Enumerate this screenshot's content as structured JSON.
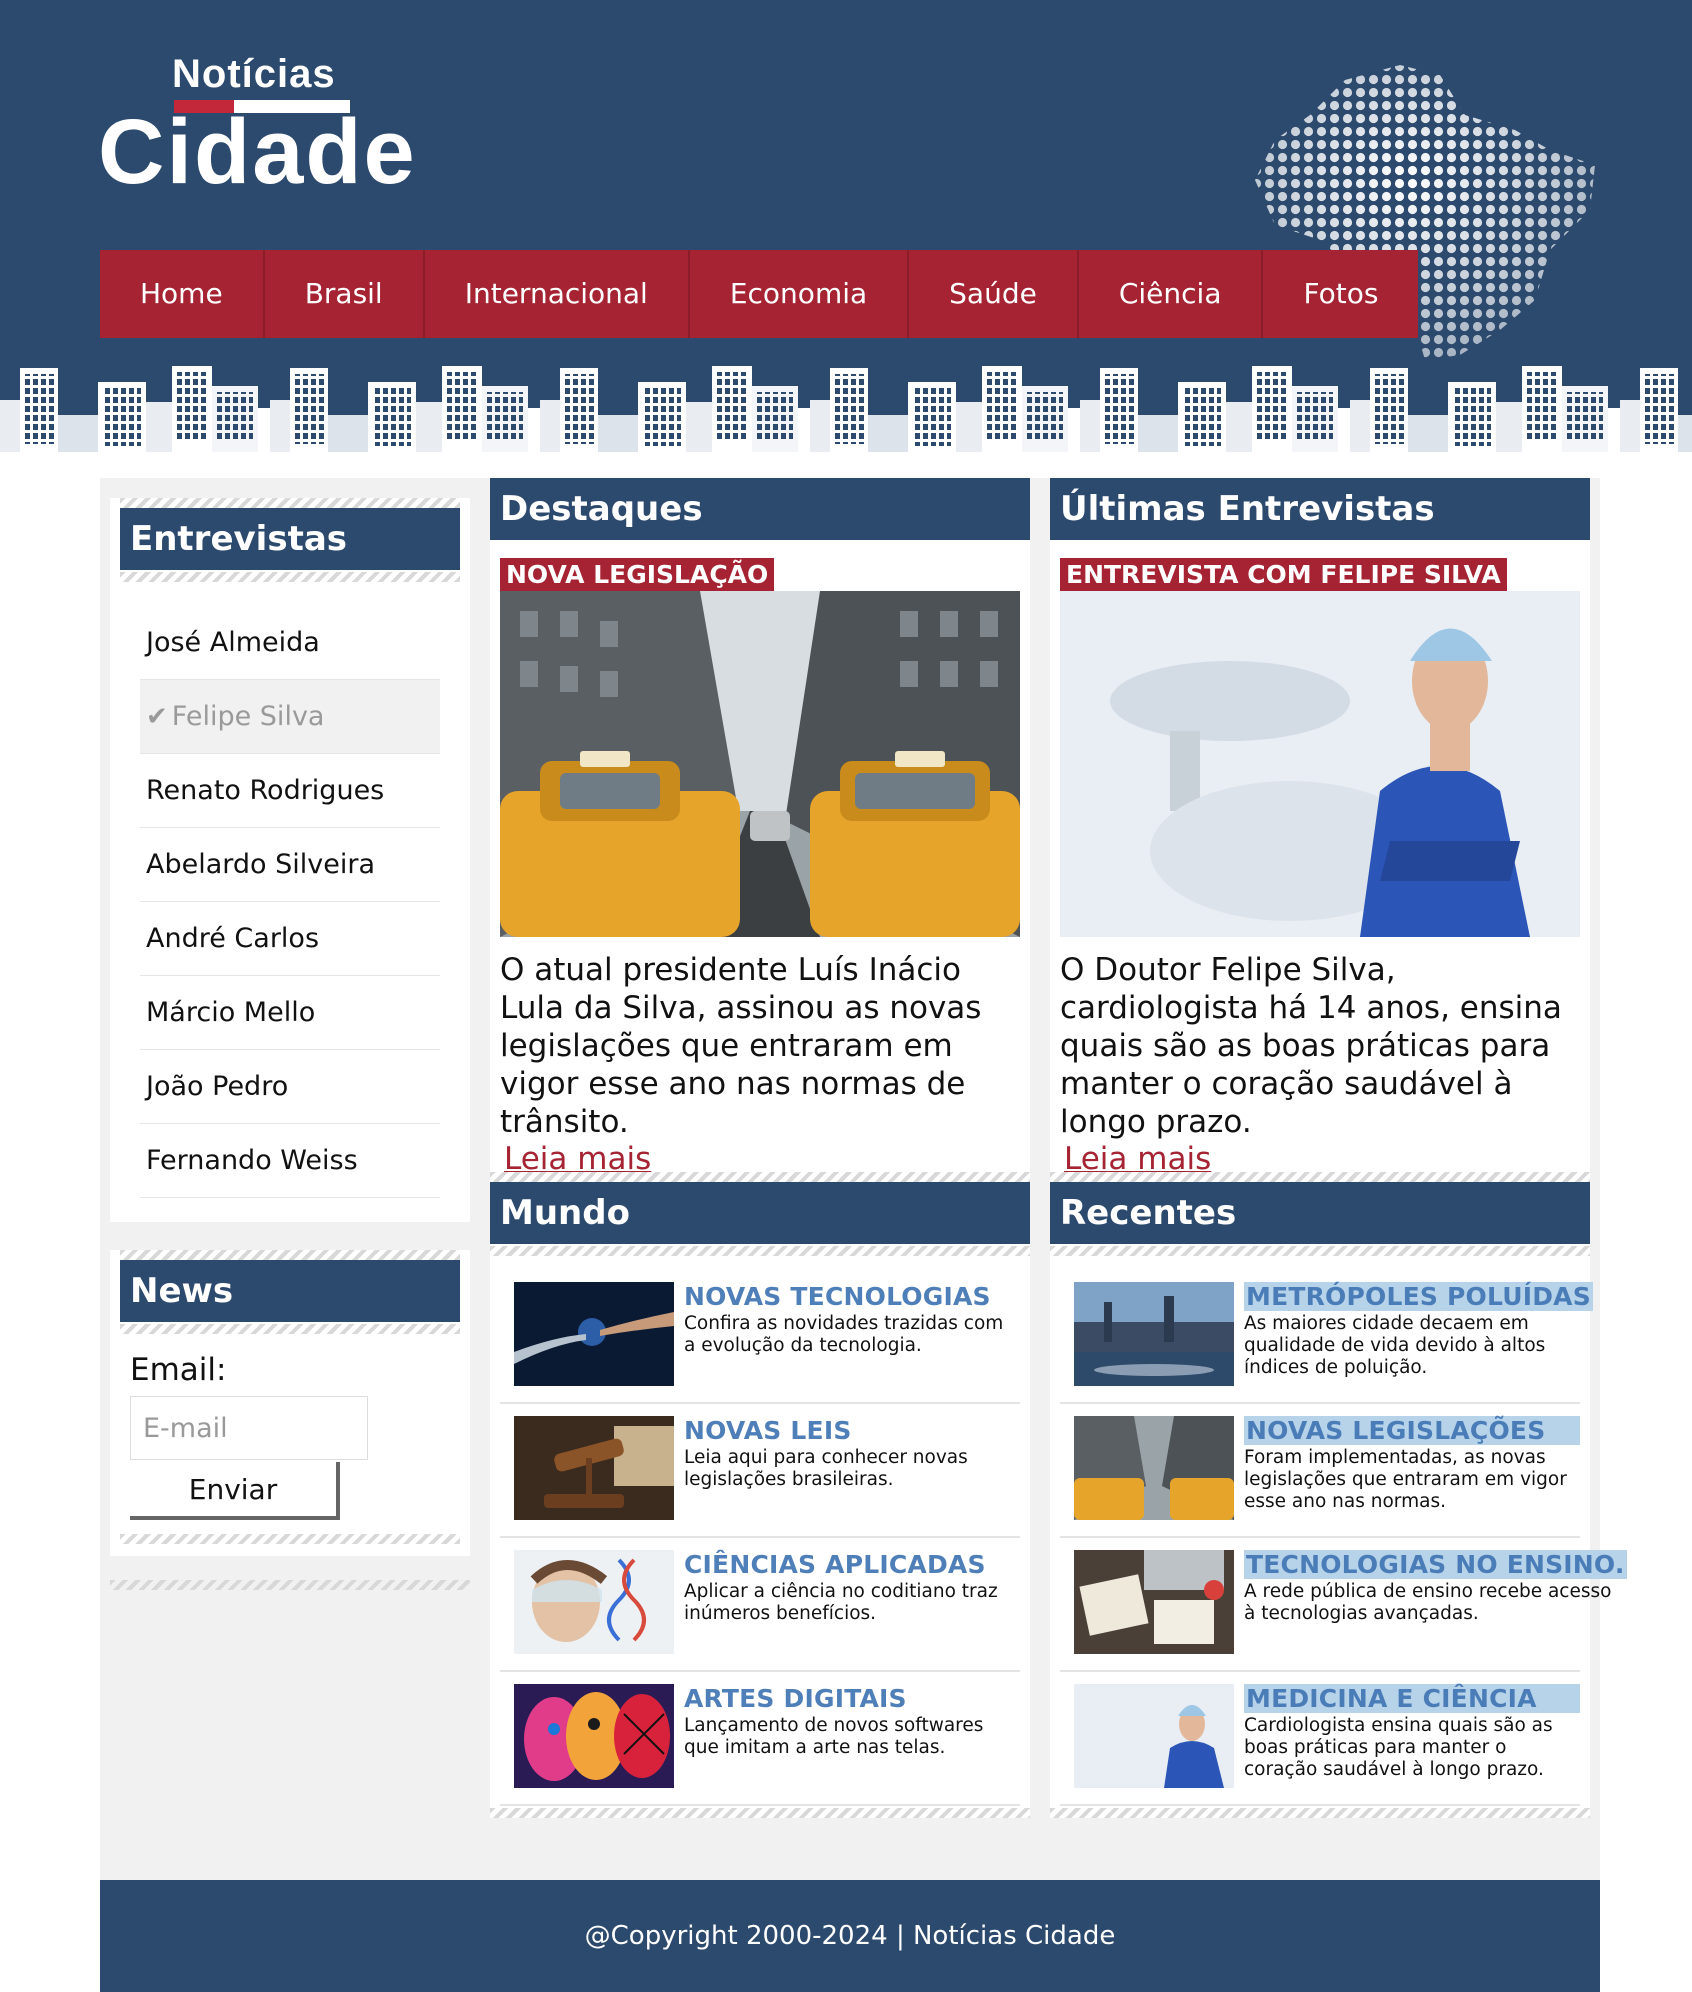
{
  "header": {
    "logo_small": "Notícias",
    "logo_big": "Cidade",
    "nav": [
      "Home",
      "Brasil",
      "Internacional",
      "Economia",
      "Saúde",
      "Ciência",
      "Fotos"
    ]
  },
  "sidebar": {
    "interviews_title": "Entrevistas",
    "interviews": [
      "José Almeida",
      "Felipe Silva",
      "Renato Rodrigues",
      "Abelardo Silveira",
      "André Carlos",
      "Márcio Mello",
      "João Pedro",
      "Fernando Weiss"
    ],
    "active_interview": "Felipe Silva",
    "news_title": "News",
    "email_label": "Email:",
    "email_placeholder": "E-mail",
    "send_label": "Enviar"
  },
  "highlights": {
    "title": "Destaques",
    "tag": "NOVA LEGISLAÇÃO",
    "text": "O atual presidente Luís Inácio Lula da Silva, assinou as novas legislações que entraram em vigor esse ano nas normas de trânsito.",
    "read_more": "Leia mais"
  },
  "latest_interviews": {
    "title": "Últimas Entrevistas",
    "tag": "ENTREVISTA COM FELIPE SILVA",
    "text": "O Doutor Felipe Silva, cardiologista há 14 anos, ensina quais são as boas práticas para manter o coração saudável à longo prazo.",
    "read_more": "Leia mais"
  },
  "world": {
    "title": "Mundo",
    "items": [
      {
        "title": "NOVAS TECNOLOGIAS",
        "desc": "Confira as novidades trazidas com a evolução da tecnologia."
      },
      {
        "title": "NOVAS LEIS",
        "desc": "Leia aqui para conhecer novas legislações brasileiras."
      },
      {
        "title": "CIÊNCIAS APLICADAS",
        "desc": "Aplicar a ciência no coditiano traz inúmeros benefícios."
      },
      {
        "title": "ARTES DIGITAIS",
        "desc": "Lançamento de novos softwares que imitam a arte nas telas."
      }
    ]
  },
  "recent": {
    "title": "Recentes",
    "items": [
      {
        "title": "METRÓPOLES POLUÍDAS",
        "desc": "As maiores cidade decaem em qualidade de vida devido à altos índices de poluição."
      },
      {
        "title": "NOVAS LEGISLAÇÕES",
        "desc": "Foram implementadas, as novas legislações que entraram em vigor esse ano nas normas."
      },
      {
        "title": "TECNOLOGIAS NO ENSINO.",
        "desc": "A rede pública de ensino recebe acesso à tecnologias avançadas."
      },
      {
        "title": "MEDICINA E CIÊNCIA",
        "desc": "Cardiologista ensina quais são as boas práticas para manter o coração saudável à longo prazo."
      }
    ]
  },
  "footer": {
    "copyright": "@Copyright 2000-2024 | Notícias Cidade"
  },
  "colors": {
    "navy": "#2c4a6e",
    "red": "#a52332",
    "link_blue": "#4f7fb8"
  }
}
